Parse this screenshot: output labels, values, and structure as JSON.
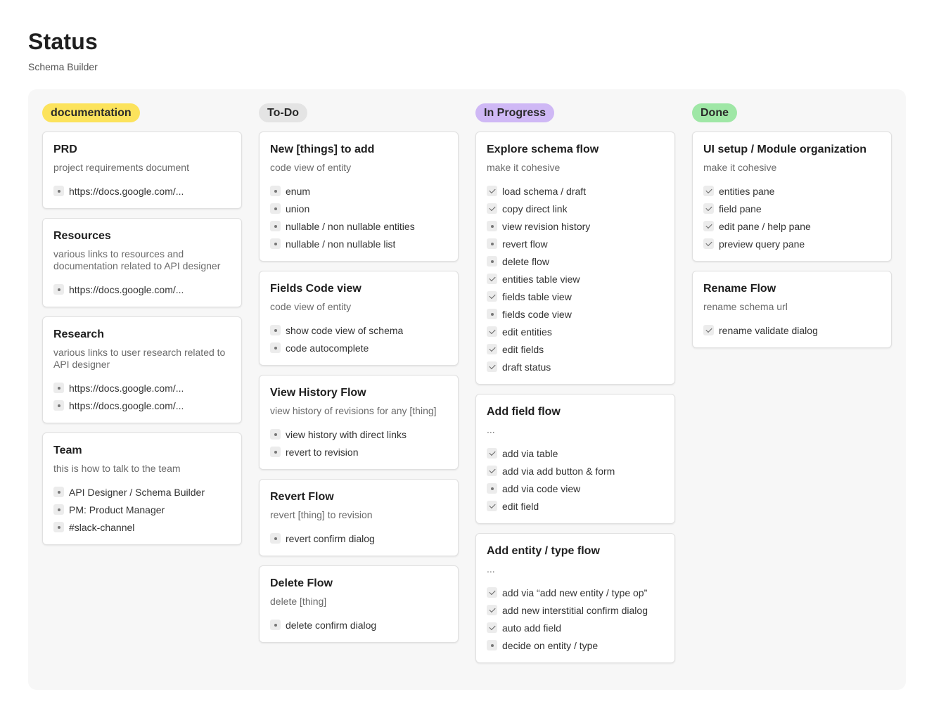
{
  "page": {
    "title": "Status",
    "subtitle": "Schema Builder"
  },
  "columns": [
    {
      "label": "documentation",
      "badge_color": "#fce35c",
      "cards": [
        {
          "title": "PRD",
          "description": "project requirements document",
          "items": [
            {
              "text": "https://docs.google.com/...",
              "icon": "bullet-icon",
              "checked": false
            }
          ]
        },
        {
          "title": "Resources",
          "description": "various links to resources and documentation related to API designer",
          "items": [
            {
              "text": "https://docs.google.com/...",
              "icon": "bullet-icon",
              "checked": false
            }
          ]
        },
        {
          "title": "Research",
          "description": "various links to user research related to API designer",
          "items": [
            {
              "text": "https://docs.google.com/...",
              "icon": "bullet-icon",
              "checked": false
            },
            {
              "text": "https://docs.google.com/...",
              "icon": "bullet-icon",
              "checked": false
            }
          ]
        },
        {
          "title": "Team",
          "description": "this is how to talk to the team",
          "items": [
            {
              "text": "API Designer / Schema Builder",
              "icon": "bullet-icon",
              "checked": false
            },
            {
              "text": "PM: Product Manager",
              "icon": "bullet-icon",
              "checked": false
            },
            {
              "text": "#slack-channel",
              "icon": "bullet-icon",
              "checked": false
            }
          ]
        }
      ]
    },
    {
      "label": "To-Do",
      "badge_color": "#e4e4e4",
      "cards": [
        {
          "title": "New [things] to add",
          "description": "code view of entity",
          "items": [
            {
              "text": "enum",
              "icon": "bullet-icon",
              "checked": false
            },
            {
              "text": "union",
              "icon": "bullet-icon",
              "checked": false
            },
            {
              "text": "nullable / non nullable entities",
              "icon": "bullet-icon",
              "checked": false
            },
            {
              "text": "nullable / non nullable list",
              "icon": "bullet-icon",
              "checked": false
            }
          ]
        },
        {
          "title": "Fields Code view",
          "description": "code view of entity",
          "items": [
            {
              "text": "show code view of schema",
              "icon": "bullet-icon",
              "checked": false
            },
            {
              "text": "code autocomplete",
              "icon": "bullet-icon",
              "checked": false
            }
          ]
        },
        {
          "title": "View History Flow",
          "description": "view history of revisions for any [thing]",
          "items": [
            {
              "text": "view history with direct links",
              "icon": "bullet-icon",
              "checked": false
            },
            {
              "text": "revert to revision",
              "icon": "bullet-icon",
              "checked": false
            }
          ]
        },
        {
          "title": "Revert Flow",
          "description": "revert [thing] to revision",
          "items": [
            {
              "text": "revert confirm dialog",
              "icon": "bullet-icon",
              "checked": false
            }
          ]
        },
        {
          "title": "Delete Flow",
          "description": "delete [thing]",
          "items": [
            {
              "text": "delete confirm dialog",
              "icon": "bullet-icon",
              "checked": false
            }
          ]
        }
      ]
    },
    {
      "label": "In Progress",
      "badge_color": "#cfb8f5",
      "cards": [
        {
          "title": "Explore schema flow",
          "description": "make it cohesive",
          "items": [
            {
              "text": "load schema / draft",
              "icon": "check-icon",
              "checked": true
            },
            {
              "text": "copy direct link",
              "icon": "check-icon",
              "checked": true
            },
            {
              "text": "view revision history",
              "icon": "bullet-icon",
              "checked": false
            },
            {
              "text": "revert flow",
              "icon": "bullet-icon",
              "checked": false
            },
            {
              "text": "delete flow",
              "icon": "bullet-icon",
              "checked": false
            },
            {
              "text": "entities table view",
              "icon": "check-icon",
              "checked": true
            },
            {
              "text": "fields table view",
              "icon": "check-icon",
              "checked": true
            },
            {
              "text": "fields code view",
              "icon": "bullet-icon",
              "checked": false
            },
            {
              "text": "edit entities",
              "icon": "check-icon",
              "checked": true
            },
            {
              "text": "edit fields",
              "icon": "check-icon",
              "checked": true
            },
            {
              "text": "draft status",
              "icon": "check-icon",
              "checked": true
            }
          ]
        },
        {
          "title": "Add field flow",
          "description": "...",
          "items": [
            {
              "text": "add via table",
              "icon": "check-icon",
              "checked": true
            },
            {
              "text": "add via add button & form",
              "icon": "check-icon",
              "checked": true
            },
            {
              "text": "add via code view",
              "icon": "bullet-icon",
              "checked": false
            },
            {
              "text": "edit field",
              "icon": "check-icon",
              "checked": true
            }
          ]
        },
        {
          "title": "Add entity / type flow",
          "description": "...",
          "items": [
            {
              "text": "add via “add new entity / type op”",
              "icon": "check-icon",
              "checked": true
            },
            {
              "text": "add new interstitial confirm dialog",
              "icon": "check-icon",
              "checked": true
            },
            {
              "text": "auto add field",
              "icon": "check-icon",
              "checked": true
            },
            {
              "text": "decide on entity / type",
              "icon": "bullet-icon",
              "checked": false
            }
          ]
        }
      ]
    },
    {
      "label": "Done",
      "badge_color": "#9fe7a6",
      "cards": [
        {
          "title": "UI setup / Module organization",
          "description": "make it cohesive",
          "items": [
            {
              "text": "entities pane",
              "icon": "check-icon",
              "checked": true
            },
            {
              "text": "field pane",
              "icon": "check-icon",
              "checked": true
            },
            {
              "text": "edit pane / help pane",
              "icon": "check-icon",
              "checked": true
            },
            {
              "text": "preview query pane",
              "icon": "check-icon",
              "checked": true
            }
          ]
        },
        {
          "title": "Rename Flow",
          "description": "rename schema url",
          "items": [
            {
              "text": "rename validate dialog",
              "icon": "check-icon",
              "checked": true
            }
          ]
        }
      ]
    }
  ]
}
